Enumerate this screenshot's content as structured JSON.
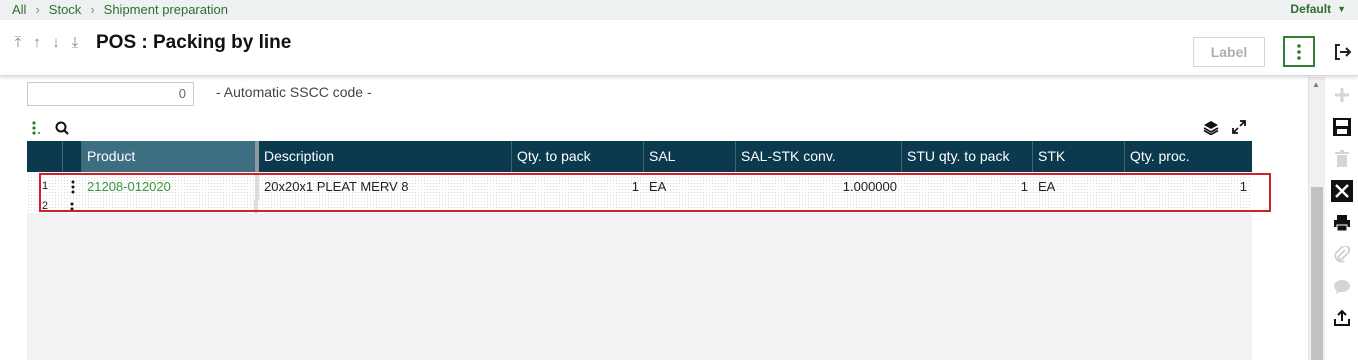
{
  "breadcrumb": {
    "items": [
      "All",
      "Stock",
      "Shipment preparation"
    ]
  },
  "default_menu": {
    "label": "Default"
  },
  "header": {
    "title": "POS : Packing by line",
    "label_button": "Label"
  },
  "sscc": {
    "value": "0",
    "label": "- Automatic SSCC code -"
  },
  "grid": {
    "columns": [
      "Product",
      "Description",
      "Qty. to pack",
      "SAL",
      "SAL-STK conv.",
      "STU qty. to pack",
      "STK",
      "Qty. proc."
    ],
    "rows": [
      {
        "num": "1",
        "product": "21208-012020",
        "description": "20x20x1 PLEAT MERV 8",
        "qty_to_pack": "1",
        "sal": "EA",
        "sal_stk_conv": "1.000000",
        "stu_qty_to_pack": "1",
        "stk": "EA",
        "qty_proc": "1"
      },
      {
        "num": "2"
      }
    ]
  },
  "colors": {
    "header_bg": "#0b3a4f",
    "accent_green": "#2e7d32",
    "link_green": "#3b9a3e",
    "highlight_red": "#d0202a"
  }
}
